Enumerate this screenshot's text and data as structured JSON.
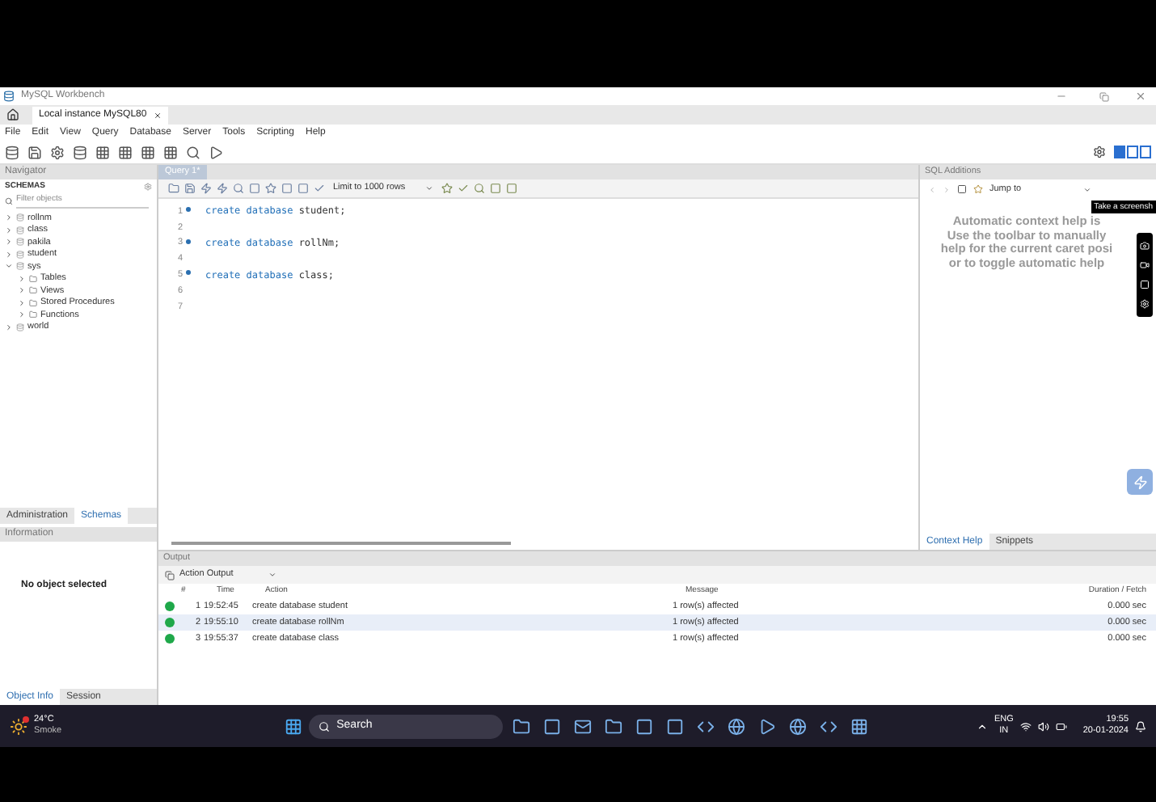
{
  "window": {
    "title": "MySQL Workbench"
  },
  "tabs": [
    {
      "label": "Local instance MySQL80",
      "selected": true
    }
  ],
  "menu": [
    "File",
    "Edit",
    "View",
    "Query",
    "Database",
    "Server",
    "Tools",
    "Scripting",
    "Help"
  ],
  "navigator": {
    "header": "Navigator",
    "schemas_title": "SCHEMAS",
    "filter_placeholder": "Filter objects",
    "tree": [
      {
        "label": "rollnm",
        "expanded": false
      },
      {
        "label": "class",
        "expanded": false
      },
      {
        "label": "pakila",
        "expanded": false
      },
      {
        "label": "student",
        "expanded": false
      },
      {
        "label": "sys",
        "expanded": true,
        "children": [
          {
            "label": "Tables"
          },
          {
            "label": "Views"
          },
          {
            "label": "Stored Procedures"
          },
          {
            "label": "Functions"
          }
        ]
      },
      {
        "label": "world",
        "expanded": false
      }
    ],
    "tabs": [
      {
        "label": "Administration",
        "selected": false
      },
      {
        "label": "Schemas",
        "selected": true
      }
    ]
  },
  "information": {
    "header": "Information",
    "message": "No object selected",
    "tabs": [
      {
        "label": "Object Info",
        "selected": true
      },
      {
        "label": "Session",
        "selected": false
      }
    ]
  },
  "editor": {
    "tab": "Query 1*",
    "limit": "Limit to 1000 rows",
    "lines": [
      {
        "number": "1",
        "keyword": "create database",
        "name": "student;"
      },
      {
        "number": "2"
      },
      {
        "number": "3",
        "keyword": "create database",
        "name": "rollNm;"
      },
      {
        "number": "4"
      },
      {
        "number": "5",
        "keyword": "create database",
        "name": "class;"
      },
      {
        "number": "6"
      },
      {
        "number": "7"
      }
    ]
  },
  "sql_additions": {
    "header": "SQL Additions",
    "jump": "Jump to",
    "help_lines": [
      "Automatic context help is",
      "Use the toolbar to manually",
      "help for the current caret posi",
      "or to toggle automatic help"
    ],
    "tabs": [
      {
        "label": "Context Help",
        "selected": true
      },
      {
        "label": "Snippets",
        "selected": false
      }
    ]
  },
  "screen_tool": {
    "tooltip": "Take a screensh"
  },
  "output": {
    "header": "Output",
    "mode": "Action Output",
    "columns": [
      "#",
      "Time",
      "Action",
      "Message",
      "Duration / Fetch"
    ],
    "rows": [
      {
        "index": "1",
        "time": "19:52:45",
        "action": "create database student",
        "message": "1 row(s) affected",
        "duration": "0.000 sec",
        "succeeded": true,
        "selected": false
      },
      {
        "index": "2",
        "time": "19:55:10",
        "action": "create database rollNm",
        "message": "1 row(s) affected",
        "duration": "0.000 sec",
        "succeeded": true,
        "selected": true
      },
      {
        "index": "3",
        "time": "19:55:37",
        "action": "create database class",
        "message": "1 row(s) affected",
        "duration": "0.000 sec",
        "succeeded": true,
        "selected": false
      }
    ]
  },
  "taskbar": {
    "temperature": "24°C",
    "weather": "Smoke",
    "search": "Search",
    "language": "ENG",
    "region": "IN",
    "time": "19:55",
    "date": "20-01-2024"
  }
}
